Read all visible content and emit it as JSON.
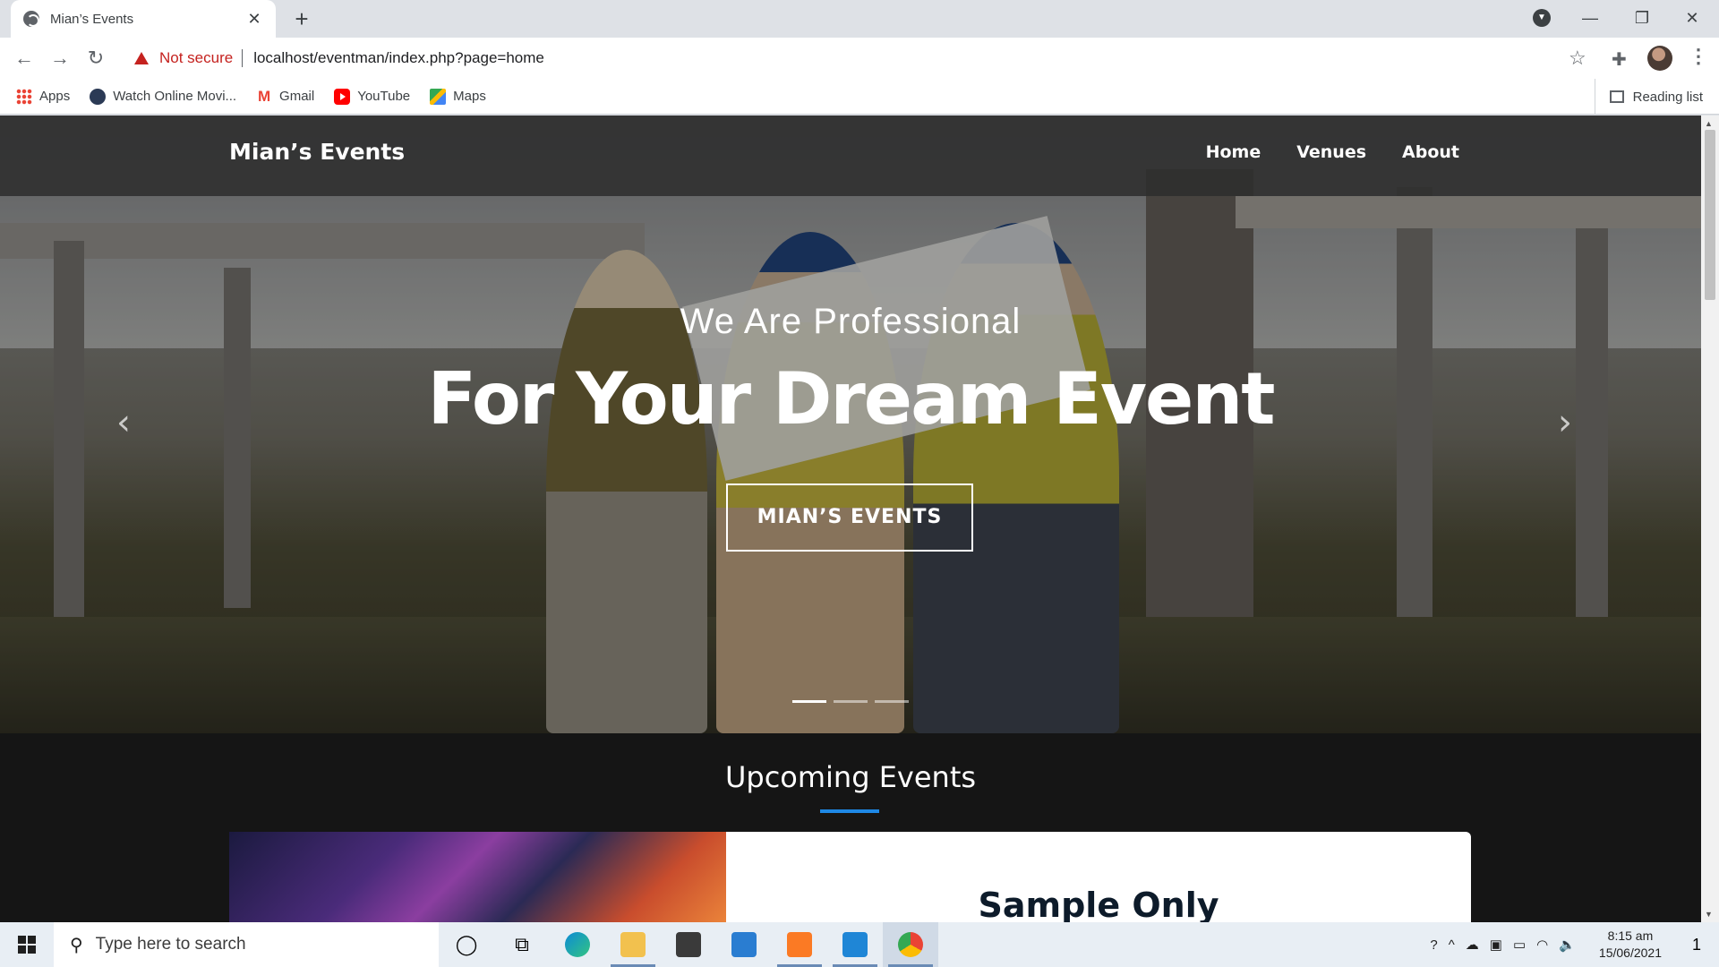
{
  "browser": {
    "tab_title": "Mian’s Events",
    "tab_close": "✕",
    "new_tab": "+",
    "security_label": "Not secure",
    "url": "localhost/eventman/index.php?page=home",
    "bookmarks": [
      {
        "label": "Apps",
        "icon": "apps-icon"
      },
      {
        "label": "Watch Online Movi...",
        "icon": "watch-icon"
      },
      {
        "label": "Gmail",
        "icon": "gmail-icon"
      },
      {
        "label": "YouTube",
        "icon": "youtube-icon"
      },
      {
        "label": "Maps",
        "icon": "maps-icon"
      }
    ],
    "reading_list": "Reading list"
  },
  "site": {
    "brand": "Mian’s Events",
    "nav": [
      "Home",
      "Venues",
      "About"
    ],
    "hero": {
      "kicker": "We Are Professional",
      "headline": "For Your Dream Event",
      "cta": "MIAN’S EVENTS",
      "prev_arrow": "‹",
      "next_arrow": "›",
      "slides": 3,
      "active_slide": 1
    },
    "section_title": "Upcoming Events",
    "card_title": "Sample Only",
    "accent_color": "#1e88e5"
  },
  "taskbar": {
    "search_placeholder": "Type here to search",
    "time": "8:15 am",
    "date": "15/06/2021",
    "notification_count": "1"
  }
}
